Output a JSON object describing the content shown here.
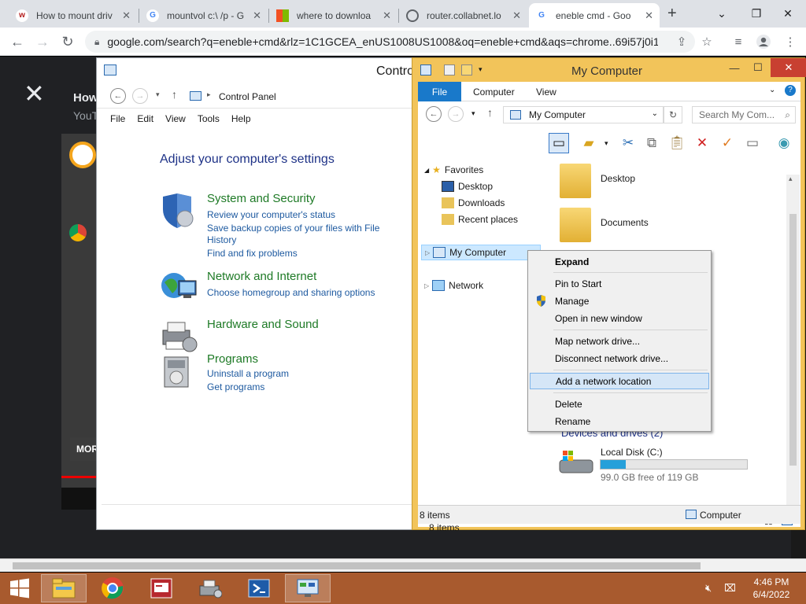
{
  "browser": {
    "tabs": [
      {
        "title": "How to mount driv",
        "favicon": "W",
        "favicon_color": "#b31b1b"
      },
      {
        "title": "mountvol c:\\ /p - G",
        "favicon": "G",
        "favicon_color": "#4285f4"
      },
      {
        "title": "where to downloa",
        "favicon": "MS",
        "favicon_color": "#f25022"
      },
      {
        "title": "router.collabnet.lo",
        "favicon": "globe",
        "favicon_color": "#5f6368"
      },
      {
        "title": "eneble cmd - Goo",
        "favicon": "G",
        "favicon_color": "#4285f4"
      }
    ],
    "url": "google.com/search?q=eneble+cmd&rlz=1C1GCEA_enUS1008US1008&oq=eneble+cmd&aqs=chrome..69i57j0i1..."
  },
  "page": {
    "overlay_title": "How",
    "overlay_sub": "YouT",
    "more_label": "MOR"
  },
  "control_panel": {
    "title": "Contro",
    "breadcrumb": "Control Panel",
    "menu": [
      "File",
      "Edit",
      "View",
      "Tools",
      "Help"
    ],
    "heading": "Adjust your computer's settings",
    "categories": [
      {
        "title": "System and Security",
        "links": [
          "Review your computer's status",
          "Save backup copies of your files with File",
          "History",
          "Find and fix problems"
        ]
      },
      {
        "title": "Network and Internet",
        "links": [
          "Choose homegroup and sharing options"
        ]
      },
      {
        "title": "Hardware and Sound",
        "links": []
      },
      {
        "title": "Programs",
        "links": [
          "Uninstall a program",
          "Get programs"
        ]
      }
    ]
  },
  "my_computer": {
    "title": "My Computer",
    "ribbon_tabs": [
      "File",
      "Computer",
      "View"
    ],
    "address": "My Computer",
    "search_placeholder": "Search My Com...",
    "nav": {
      "favorites": "Favorites",
      "fav_items": [
        "Desktop",
        "Downloads",
        "Recent places"
      ],
      "my_computer": "My Computer",
      "network": "Network"
    },
    "folders": [
      "Desktop",
      "Documents"
    ],
    "group_label": "Devices and drives (2)",
    "drive": {
      "name": "Local Disk (C:)",
      "free_text": "99.0 GB free of 119 GB",
      "used_fraction": 0.17
    },
    "items_count": "8 items",
    "status_items": "8 items",
    "status_right": "Computer"
  },
  "context_menu": {
    "items": [
      "Expand",
      "Pin to Start",
      "Manage",
      "Open in new window",
      "Map network drive...",
      "Disconnect network drive...",
      "Add a network location",
      "Delete",
      "Rename"
    ],
    "highlighted": "Add a network location"
  },
  "taskbar": {
    "time": "4:46 PM",
    "date": "6/4/2022",
    "accent": "#a85a2e"
  }
}
